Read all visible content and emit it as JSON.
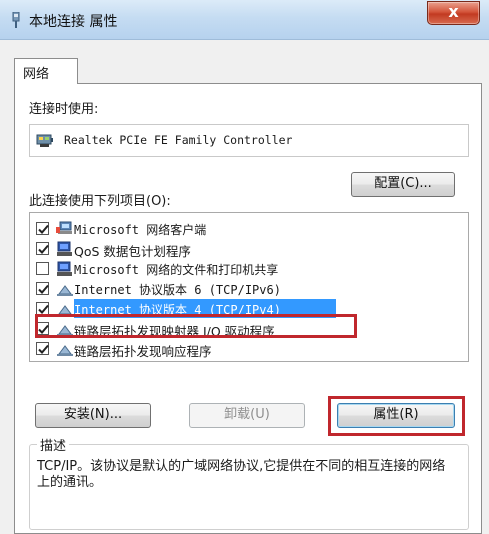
{
  "window": {
    "title": "本地连接 属性",
    "close_label": "x"
  },
  "tabs": [
    {
      "label": "网络"
    }
  ],
  "connect_using": {
    "label": "连接时使用:",
    "adapter_name": "Realtek PCIe FE Family Controller",
    "configure_label": "配置(C)..."
  },
  "items_section": {
    "label": "此连接使用下列项目(O):",
    "items": [
      {
        "label": "Microsoft 网络客户端",
        "checked": true,
        "icon": "network-client-icon"
      },
      {
        "label": "QoS 数据包计划程序",
        "checked": true,
        "icon": "service-icon"
      },
      {
        "label": "Microsoft 网络的文件和打印机共享",
        "checked": false,
        "icon": "service-icon"
      },
      {
        "label": "Internet 协议版本 6 (TCP/IPv6)",
        "checked": true,
        "icon": "protocol-icon"
      },
      {
        "label": "Internet 协议版本 4 (TCP/IPv4)",
        "checked": true,
        "icon": "protocol-icon",
        "selected": true
      },
      {
        "label": "链路层拓扑发现映射器 I/O 驱动程序",
        "checked": true,
        "icon": "protocol-icon"
      },
      {
        "label": "链路层拓扑发现响应程序",
        "checked": true,
        "icon": "protocol-icon"
      }
    ]
  },
  "buttons": {
    "install_label": "安装(N)...",
    "uninstall_label": "卸载(U)",
    "properties_label": "属性(R)"
  },
  "description": {
    "legend": "描述",
    "text": "TCP/IP。该协议是默认的广域网络协议,它提供在不同的相互连接的网络上的通讯。"
  },
  "colors": {
    "highlight": "#c0272d",
    "selection": "#3399ff"
  }
}
